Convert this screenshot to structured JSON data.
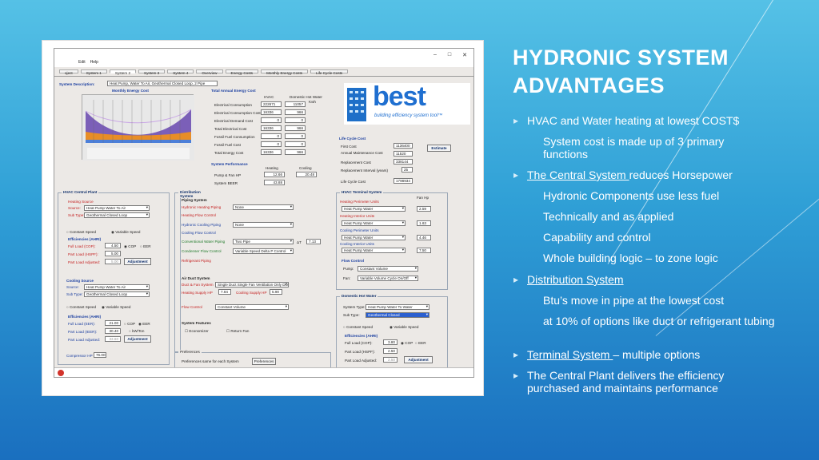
{
  "slide": {
    "title": "HYDRONIC SYSTEM ADVANTAGES",
    "bullets": [
      {
        "text": "HVAC and Water heating at lowest COST$"
      },
      {
        "text": "System cost is made up of 3 primary functions"
      },
      {
        "text_ul": "The Central System ",
        "text_rest": "reduces Horsepower"
      },
      {
        "text": "Hydronic Components use less fuel"
      },
      {
        "text": "Technically and as applied"
      },
      {
        "text": "Capability and control"
      },
      {
        "text": "Whole building logic – to zone logic"
      },
      {
        "text_ul": "Distribution System",
        "text_rest": ""
      },
      {
        "text": "Btu’s move in pipe at the lowest cost"
      },
      {
        "text": "at 10% of options like duct or refrigerant tubing"
      },
      {
        "text_ul": "Terminal System ",
        "text_rest": "– multiple options"
      },
      {
        "text": "The Central Plant delivers the efficiency purchased and maintains performance"
      }
    ]
  },
  "app": {
    "menu": [
      "Edit",
      "Help"
    ],
    "tabs": [
      "oject",
      "System 1",
      "System 2",
      "System 3",
      "System 4",
      "Overview",
      "Energy Costs",
      "Monthly Energy Costs",
      "Life Cycle Costs"
    ],
    "system_description_label": "System Description:",
    "system_description_value": "Heat Pump, Water To Air, Geothermal Closed Loop, 2 Pipe",
    "monthly_chart_title": "Monthly Energy Cost",
    "tae": {
      "title": "Total Annual Energy Cost",
      "col1": "HVAC",
      "col2": "Domestic Hot Water",
      "unit": "Kwh",
      "rows": [
        {
          "label": "Electrical Consumption",
          "v1": "222671",
          "v2": "11057"
        },
        {
          "label": "Electrical Consumption Cost",
          "v1": "16336",
          "v2": "966"
        },
        {
          "label": "Electrical Demand Cost",
          "v1": "0",
          "v2": "0"
        },
        {
          "label": "Total Electrical Cost",
          "v1": "16336",
          "v2": "966"
        },
        {
          "label": "Fossil Fuel Consumption",
          "v1": "0",
          "v2": "0"
        },
        {
          "label": "Fossil Fuel Cost",
          "v1": "0",
          "v2": "0"
        },
        {
          "label": "Total Energy Cost",
          "v1": "16336",
          "v2": "966"
        }
      ]
    },
    "logo": {
      "word": "best",
      "tag": "building efficiency system tool™"
    },
    "lcc": {
      "title": "Life Cycle Cost",
      "rows": [
        {
          "label": "First Cost",
          "v": "1136400"
        },
        {
          "label": "Annual Maintenance Cost",
          "v": "11520"
        },
        {
          "label": "Replacement Cost",
          "v": "338144"
        },
        {
          "label": "Replacement Interval (years)",
          "v": "25"
        },
        {
          "label": "Life Cycle Cost",
          "v": "1798934"
        }
      ],
      "estimate": "Estimate"
    },
    "perf": {
      "title": "System Performance",
      "col1": "Heating",
      "col2": "Cooling",
      "r1": "Pump & Fan HP",
      "r1v1": "12.66",
      "r1v2": "20.48",
      "r2": "System BEER",
      "r2v1": "43.88"
    },
    "plant": {
      "title": "HVAC Central Plant",
      "heating_source": "Heating Source",
      "source_label": "Source:",
      "source_value": "Heat Pump Water To Air",
      "subtype_label": "Sub Type:",
      "subtype_value": "Geothermal Closed Loop",
      "const_speed": "Constant Speed",
      "var_speed": "Variable Speed",
      "eff": "Efficiencies (AHRI)",
      "full_load": "Full Load (COP):",
      "full_load_v": "4.50",
      "part_load": "Part Load (HSPF):",
      "part_load_v": "5.00",
      "part_adj": "Part Load Adjusted:",
      "part_adj_v": "5.00",
      "cop": "COP",
      "eer": "EER",
      "adjustment": "Adjustment",
      "cooling_source": "Cooling Source",
      "c_source_value": "Heat Pump Water To Air",
      "c_subtype_value": "Geothermal Closed Loop",
      "c_full_load": "Full Load (EER):",
      "c_full_load_v": "21.00",
      "c_part_load": "Part Load (IEER):",
      "c_part_load_v": "30.40",
      "c_part_adj": "Part Load Adjusted:",
      "c_part_adj_v": "33.60",
      "kw": "kW/Ton",
      "compressor": "Compressor HP",
      "compressor_v": "76.00"
    },
    "dist": {
      "title": "Distribution System",
      "piping": "Piping System",
      "hyd_heat": "Hydronic Heating Piping",
      "hyd_heat_v": "None",
      "heat_flow": "Heating Flow Control",
      "hyd_cool": "Hydronic Cooling Piping",
      "hyd_cool_v": "None",
      "cool_flow": "Cooling Flow Control",
      "conv_water": "Conventional Water Piping",
      "conv_water_v": "Two Pipe",
      "delta_label": "ΔT",
      "delta_v": "7.13",
      "cond_flow": "Condenser Flow Control",
      "cond_flow_v": "Variable Speed Delta P Control",
      "refrig": "Refrigerant Piping",
      "air_duct": "Air Duct System",
      "duct_system": "Duct & Fan System",
      "duct_system_v": "Single Duct Single Fan Ventilation Only DOAS",
      "heat_hp": "Heating Supply HP",
      "heat_hp_v": "7.84",
      "cool_hp": "Cooling Supply HP",
      "cool_hp_v": "5.90",
      "flow_control": "Flow Control",
      "flow_control_v": "Constant Volume",
      "features": "System Features",
      "economizer": "Economizer",
      "return_fan": "Return Fan",
      "prefs": "Preferences",
      "prefs_same": "Preferences same for each System",
      "prefs_btn": "Preferences"
    },
    "terminal": {
      "title": "HVAC Terminal System",
      "fan_hp": "Fan Hp",
      "hp_units": "Heating Perimeter Units",
      "hp_units_v": "Heat Pump Water",
      "hp_units_n": "2.59",
      "hi_units": "Heating Interior Units",
      "hi_units_v": "Heat Pump Water",
      "hi_units_n": "1.63",
      "cp_units": "Cooling Perimeter Units",
      "cp_units_v": "Heat Pump Water",
      "cp_units_n": "4.46",
      "ci_units": "Cooling Interior Units",
      "ci_units_v": "Heat Pump Water",
      "ci_units_n": "7.50",
      "flow": "Flow Control",
      "pump": "Pump:",
      "pump_v": "Constant Volume",
      "fan": "Fan:",
      "fan_v": "Variable Volume Cycle On/Off"
    },
    "dhw": {
      "title": "Domestic Hot Water",
      "sys_type": "System Type:",
      "sys_type_v": "Heat Pump Water To Water",
      "sub_type": "Sub Type:",
      "sub_type_v": "Geothermal Closed",
      "const": "Constant Speed",
      "var": "Variable Speed",
      "eff": "Efficiencies (AHRI)",
      "fl": "Full Load (COP):",
      "fl_v": "3.80",
      "pl": "Part Load (HSPF):",
      "pl_v": "2.50",
      "pa": "Part Load Adjusted:",
      "pa_v": "2.50",
      "cop": "COP",
      "eer": "EER",
      "adjustment": "Adjustment"
    }
  },
  "colors": {
    "accent": "#2f9fd6",
    "chart_purple": "#7b5fb8",
    "chart_orange": "#e88d27",
    "chart_blue": "#4c7fd9"
  }
}
